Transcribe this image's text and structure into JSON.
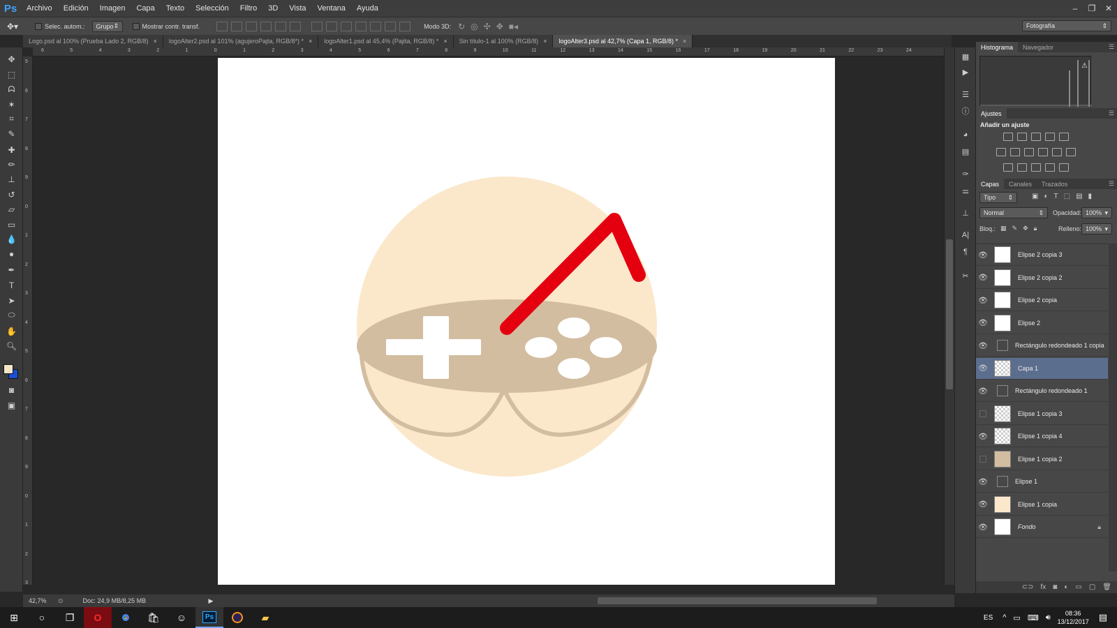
{
  "app": {
    "logo": "Ps",
    "accent_color": "#3fa3ff"
  },
  "menu": [
    "Archivo",
    "Edición",
    "Imagen",
    "Capa",
    "Texto",
    "Selección",
    "Filtro",
    "3D",
    "Vista",
    "Ventana",
    "Ayuda"
  ],
  "window_controls": {
    "minimize": "–",
    "restore": "❐",
    "close": "✕"
  },
  "options": {
    "auto_select_label": "Selec. autom.:",
    "auto_select_value": "Grupo",
    "show_transform_label": "Mostrar contr. transf.",
    "mode3d_label": "Modo 3D:",
    "workspace": "Fotografía"
  },
  "tabs": [
    {
      "label": "Logo.psd al 100% (Prueba Lado 2, RGB/8)",
      "close": "×"
    },
    {
      "label": "logoAlter2.psd al 101% (agujeroPajta, RGB/8*) *",
      "close": "×"
    },
    {
      "label": "logoAlter1.psd al 45,4% (Pajita, RGB/8) *",
      "close": "×"
    },
    {
      "label": "Sin título-1 al 100% (RGB/8)",
      "close": "×"
    },
    {
      "label": "logoAlter3.psd al 42,7% (Capa 1, RGB/8) *",
      "close": "×"
    }
  ],
  "ruler": {
    "h_ticks": [
      "6",
      "5",
      "4",
      "3",
      "2",
      "1",
      "0",
      "1",
      "2",
      "3",
      "4",
      "5",
      "6",
      "7",
      "8",
      "9",
      "10",
      "11",
      "12",
      "13",
      "14",
      "15",
      "16",
      "17",
      "18",
      "19",
      "20",
      "21",
      "22",
      "23",
      "24"
    ],
    "v_ticks": [
      "5",
      "6",
      "7",
      "8",
      "9",
      "0",
      "1",
      "2",
      "3",
      "4",
      "5",
      "6",
      "7",
      "8",
      "9",
      "0",
      "1",
      "2",
      "3"
    ]
  },
  "status": {
    "zoom": "42,7%",
    "doc": "Doc: 24,9 MB/8,25 MB"
  },
  "colors": {
    "foreground": "#f6e6c8",
    "background": "#1a4fd6",
    "circle": "#fbe8cb",
    "controller": "#d2bda0",
    "straw": "#e4000f",
    "buttons": "#ffffff"
  },
  "panels": {
    "histogram_tabs": [
      "Histograma",
      "Navegador"
    ],
    "adjust_tab": "Ajustes",
    "adjust_title": "Añadir un ajuste",
    "layer_tabs": [
      "Capas",
      "Canales",
      "Trazados"
    ],
    "filter_kind": "Tipo",
    "blend_mode": "Normal",
    "opacity_label": "Opacidad:",
    "opacity_value": "100%",
    "lock_label": "Bloq.:",
    "fill_label": "Relleno:",
    "fill_value": "100%"
  },
  "layers": [
    {
      "name": "Elipse 2 copia 3",
      "visible": true,
      "thumb": "white",
      "selected": false,
      "italic": false
    },
    {
      "name": "Elipse 2 copia 2",
      "visible": true,
      "thumb": "white",
      "selected": false,
      "italic": false
    },
    {
      "name": "Elipse 2 copia",
      "visible": true,
      "thumb": "white",
      "selected": false,
      "italic": false
    },
    {
      "name": "Elipse 2",
      "visible": true,
      "thumb": "white",
      "selected": false,
      "italic": false
    },
    {
      "name": "Rectángulo redondeado 1 copia",
      "visible": true,
      "thumb": "shape",
      "selected": false,
      "italic": false
    },
    {
      "name": "Capa 1",
      "visible": true,
      "thumb": "checker",
      "selected": true,
      "italic": false
    },
    {
      "name": "Rectángulo redondeado 1",
      "visible": true,
      "thumb": "shape",
      "selected": false,
      "italic": false
    },
    {
      "name": "Elipse 1 copia 3",
      "visible": false,
      "thumb": "checker",
      "selected": false,
      "italic": false
    },
    {
      "name": "Elipse 1 copia 4",
      "visible": true,
      "thumb": "checker",
      "selected": false,
      "italic": false
    },
    {
      "name": "Elipse 1 copia 2",
      "visible": false,
      "thumb": "tan",
      "selected": false,
      "italic": false
    },
    {
      "name": "Elipse 1",
      "visible": true,
      "thumb": "shape",
      "selected": false,
      "italic": false
    },
    {
      "name": "Elipse 1 copia",
      "visible": true,
      "thumb": "cream",
      "selected": false,
      "italic": false
    },
    {
      "name": "Fondo",
      "visible": true,
      "thumb": "white",
      "selected": false,
      "italic": true
    }
  ],
  "taskbar": {
    "lang": "ES",
    "time": "08:36",
    "date": "13/12/2017"
  }
}
